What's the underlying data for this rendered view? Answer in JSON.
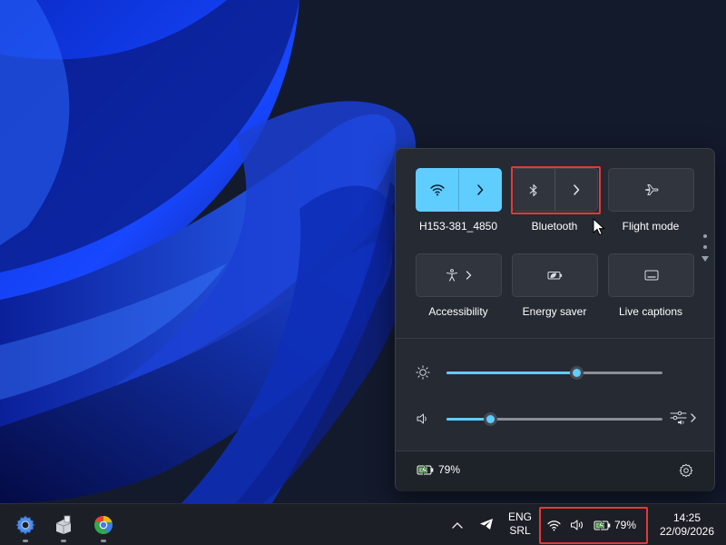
{
  "quick_settings": {
    "tiles": [
      {
        "id": "wifi",
        "label": "H153-381_4850",
        "icon": "wifi-icon",
        "active": true,
        "expandable": true
      },
      {
        "id": "bluetooth",
        "label": "Bluetooth",
        "icon": "bluetooth-icon",
        "active": false,
        "expandable": true
      },
      {
        "id": "flight",
        "label": "Flight mode",
        "icon": "airplane-icon",
        "active": false,
        "expandable": false
      },
      {
        "id": "accessibility",
        "label": "Accessibility",
        "icon": "accessibility-icon",
        "active": false,
        "expandable": true
      },
      {
        "id": "energy",
        "label": "Energy saver",
        "icon": "energy-saver-icon",
        "active": false,
        "expandable": false
      },
      {
        "id": "captions",
        "label": "Live captions",
        "icon": "live-captions-icon",
        "active": false,
        "expandable": false
      }
    ],
    "brightness_percent": 60,
    "volume_percent": 20,
    "battery_text": "79%",
    "battery_percent": 79
  },
  "taskbar": {
    "pinned_apps": [
      "settings-app-icon",
      "file-app-icon",
      "browser-app-icon"
    ],
    "language": {
      "line1": "ENG",
      "line2": "SRL"
    },
    "tray_battery_text": "79%",
    "clock": {
      "time": "14:25",
      "date": "22/09/2026"
    }
  },
  "colors": {
    "accent": "#60cdff",
    "highlight": "#e53935",
    "panel_bg": "#252a33"
  }
}
